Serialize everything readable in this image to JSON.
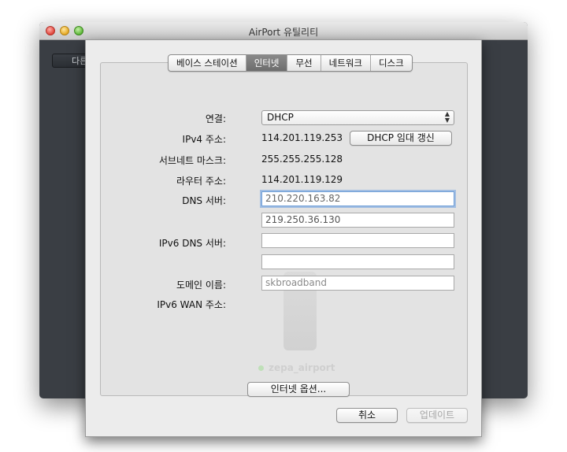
{
  "window": {
    "title": "AirPort 유틸리티"
  },
  "background": {
    "other_button_label": "다른 Wi-Fi"
  },
  "ghost": {
    "device_name": "zepa_airport"
  },
  "tabs": [
    "베이스 스테이션",
    "인터넷",
    "무선",
    "네트워크",
    "디스크"
  ],
  "active_tab": "인터넷",
  "form": {
    "connection_label": "연결:",
    "connection_value": "DHCP",
    "ipv4_label": "IPv4 주소:",
    "ipv4_value": "114.201.119.253",
    "renew_button": "DHCP 임대 갱신",
    "subnet_label": "서브네트 마스크:",
    "subnet_value": "255.255.255.128",
    "router_label": "라우터 주소:",
    "router_value": "114.201.119.129",
    "dns_label": "DNS 서버:",
    "dns1": "210.220.163.82",
    "dns2": "219.250.36.130",
    "ipv6_dns_label": "IPv6 DNS 서버:",
    "ipv6_dns1": "",
    "ipv6_dns2": "",
    "domain_label": "도메인 이름:",
    "domain_placeholder": "skbroadband",
    "ipv6_wan_label": "IPv6 WAN 주소:",
    "internet_options_button": "인터넷 옵션..."
  },
  "footer": {
    "cancel": "취소",
    "update": "업데이트"
  }
}
